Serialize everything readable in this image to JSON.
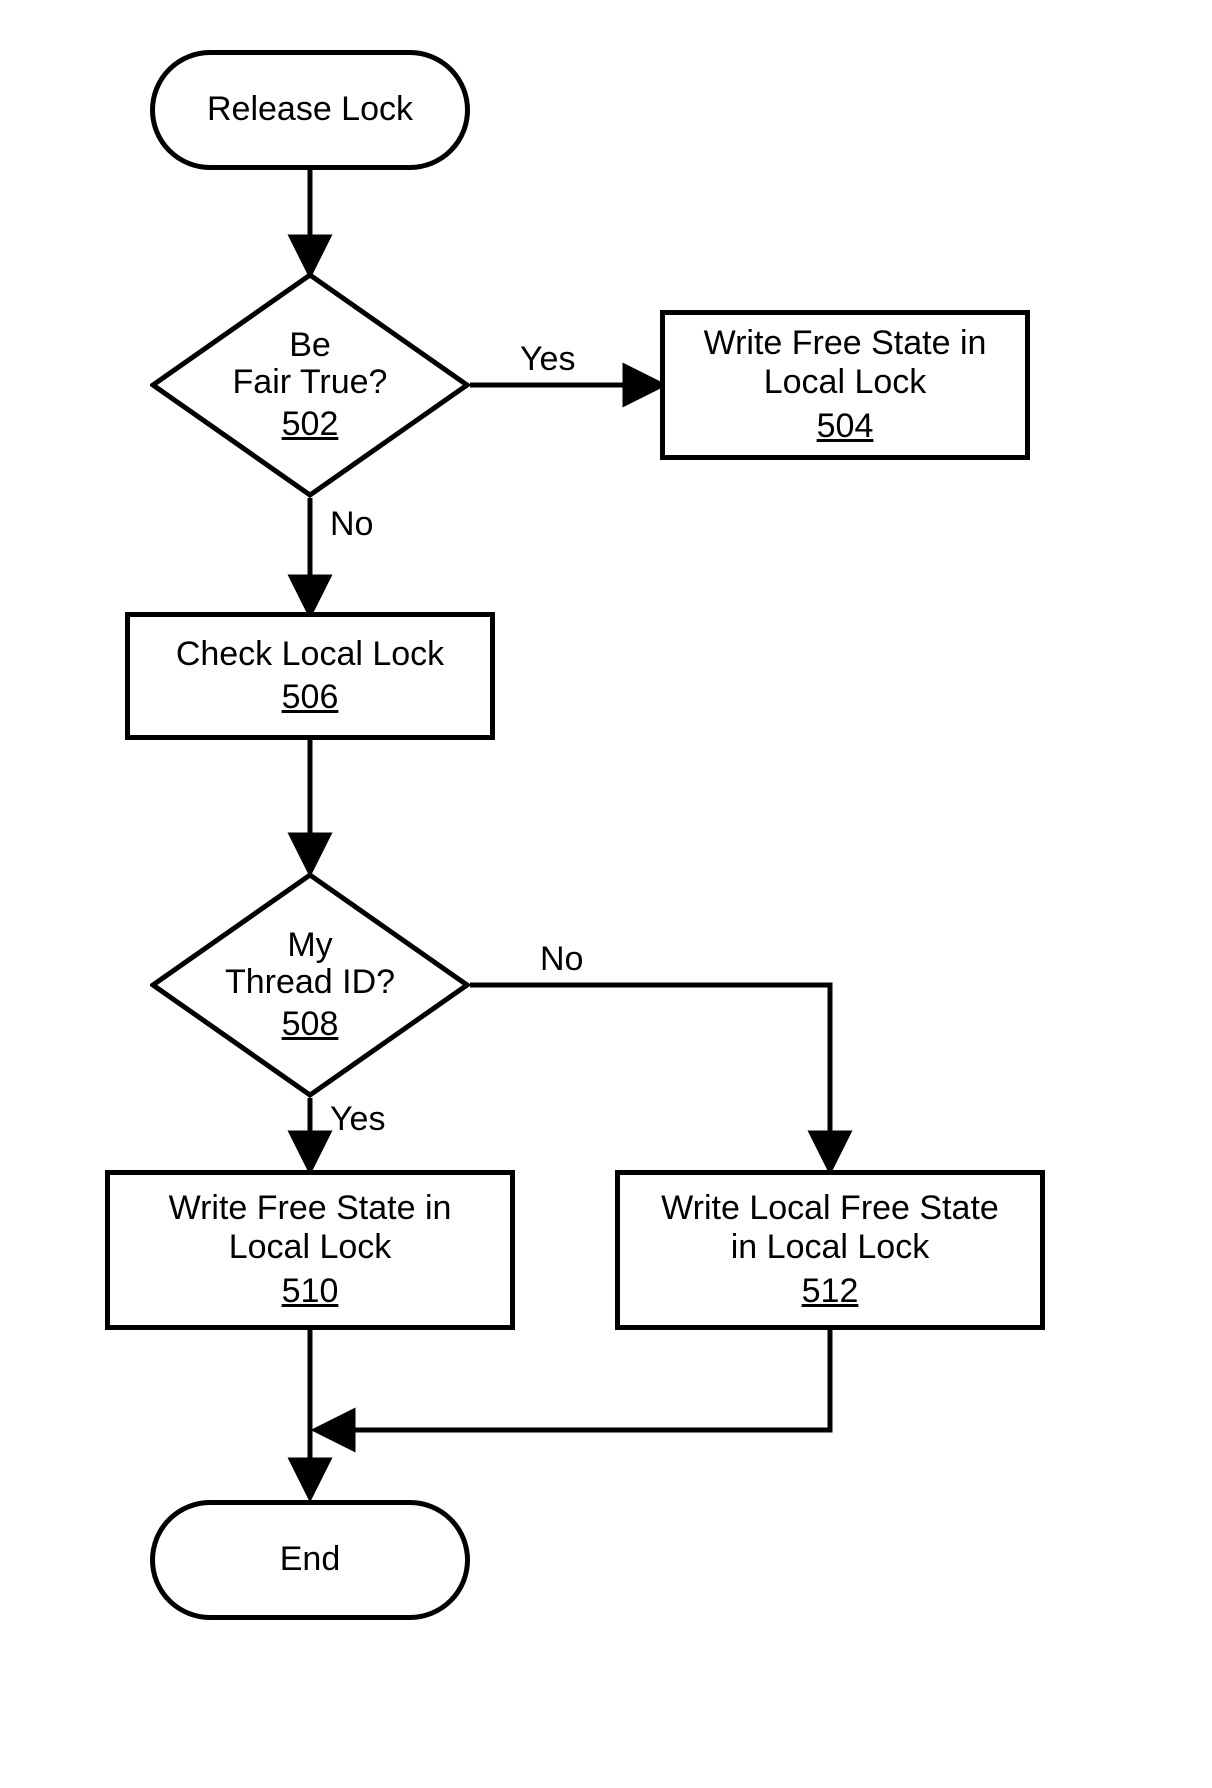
{
  "nodes": {
    "start": {
      "label": "Release Lock"
    },
    "d1": {
      "label_l1": "Be",
      "label_l2": "Fair True?",
      "ref": "502"
    },
    "p504": {
      "label": "Write Free State in\nLocal Lock",
      "ref": "504"
    },
    "p506": {
      "label": "Check Local Lock",
      "ref": "506"
    },
    "d2": {
      "label_l1": "My",
      "label_l2": "Thread ID?",
      "ref": "508"
    },
    "p510": {
      "label": "Write Free State in\nLocal Lock",
      "ref": "510"
    },
    "p512": {
      "label": "Write Local Free State\nin Local Lock",
      "ref": "512"
    },
    "end": {
      "label": "End"
    }
  },
  "edges": {
    "d1_yes": "Yes",
    "d1_no": "No",
    "d2_yes": "Yes",
    "d2_no": "No"
  }
}
